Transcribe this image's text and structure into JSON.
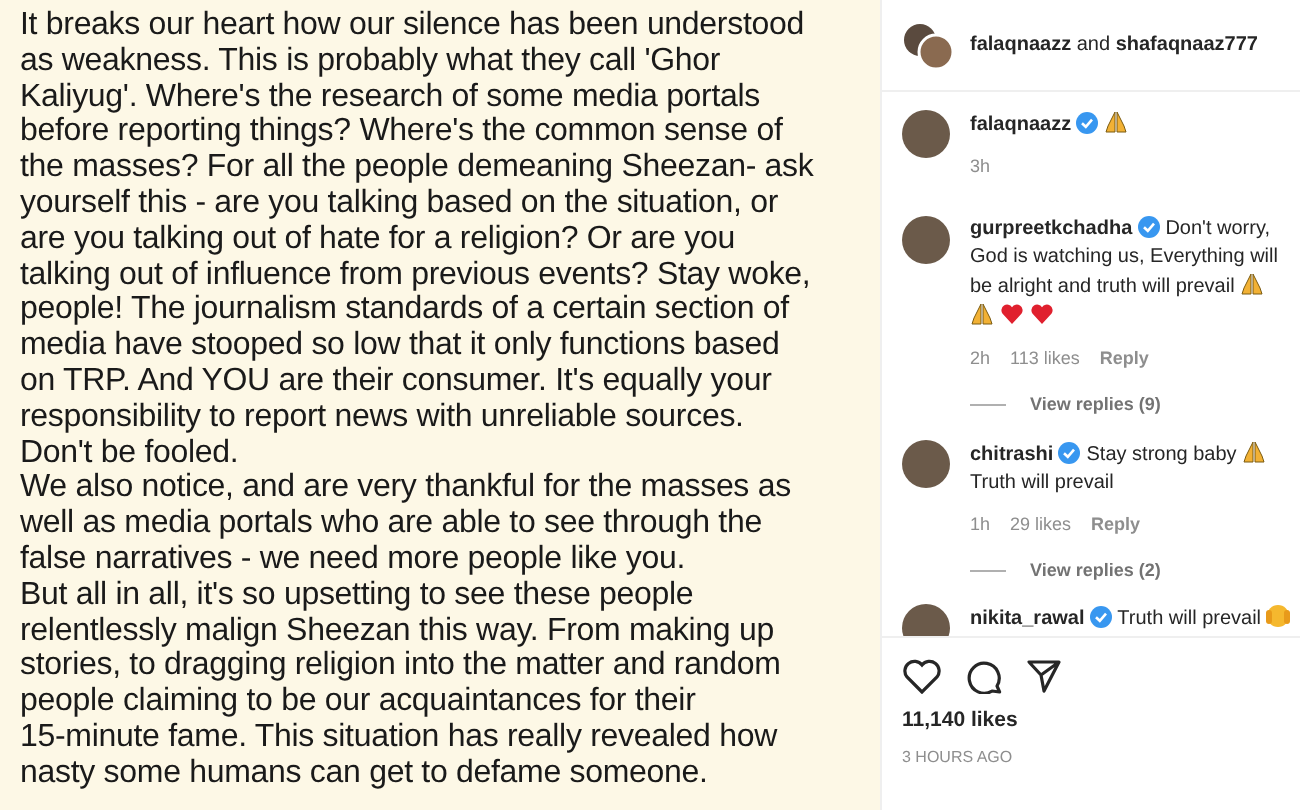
{
  "post": {
    "paragraphs": [
      "It breaks our heart how our silence has been understood\nas weakness. This is probably what they call 'Ghor\nKaliyug'. Where's the research of some media portals\nbefore reporting things? Where's the common sense of\nthe masses? For all the people demeaning Sheezan- ask\nyourself this - are you talking based on the situation, or\nare you talking out of hate for a religion? Or are you\ntalking out of influence from previous events? Stay woke,\npeople! The journalism standards of a certain section of\nmedia have stooped so low that it only functions based\non TRP. And YOU are their consumer. It's equally your\nresponsibility to report news with unreliable sources.\nDon't be fooled.",
      "We also notice, and are very thankful for the masses as\nwell as media portals who are able to see through the\nfalse narratives - we need more people like you.",
      "But all in all, it's so upsetting to see these people\nrelentlessly malign Sheezan this way. From making up\nstories, to dragging religion into the matter and random\npeople claiming to be our acquaintances for their\n15-minute fame. This situation has really revealed how\nnasty some humans can get to defame someone."
    ]
  },
  "header": {
    "user_1": "falaqnaazz",
    "joiner": "and",
    "user_2": "shafaqnaaz777"
  },
  "comments": [
    {
      "user": "falaqnaazz",
      "verified": true,
      "icons": [
        {
          "kind": "pray"
        }
      ],
      "time": "3h"
    },
    {
      "user": "gurpreetkchadha",
      "verified": true,
      "text": "Don't worry, God is watching us, Everything will be alright and truth will prevail",
      "icons": [
        {
          "kind": "pray"
        },
        {
          "kind": "pray"
        },
        {
          "kind": "heart"
        },
        {
          "kind": "heart"
        }
      ],
      "time": "2h",
      "likes": "113 likes",
      "reply": "Reply",
      "view_replies": "View replies (9)"
    },
    {
      "user": "chitrashi",
      "verified": true,
      "text": "Stay strong baby",
      "icons": [
        {
          "kind": "pray"
        }
      ],
      "text_2": "Truth will prevail",
      "time": "1h",
      "likes": "29 likes",
      "reply": "Reply",
      "view_replies": "View replies (2)"
    },
    {
      "user": "nikita_rawal",
      "verified": true,
      "text": "Truth will prevail",
      "icons": [
        {
          "kind": "face"
        }
      ]
    }
  ],
  "likes": "11,140 likes",
  "time": "3 HOURS AGO"
}
